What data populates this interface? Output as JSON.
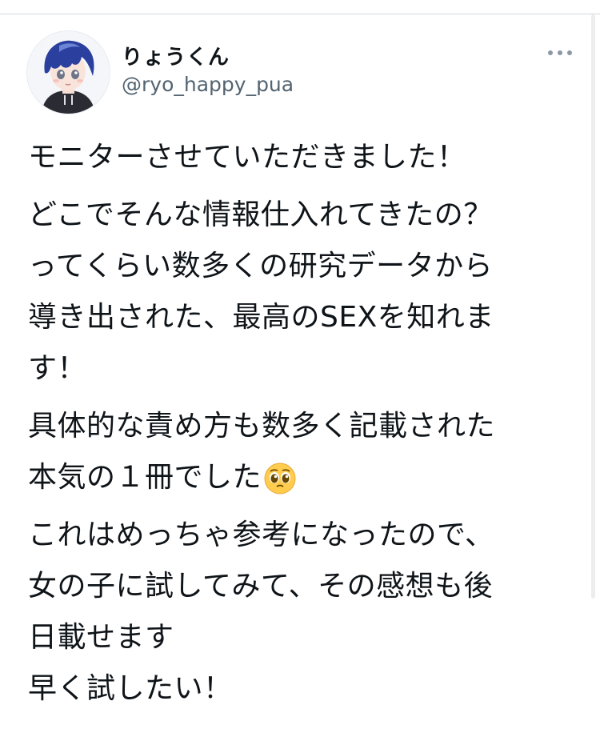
{
  "tweet": {
    "author": {
      "display_name": "りょうくん",
      "handle": "@ryo_happy_pua",
      "avatar_icon": "anime-boy-avatar"
    },
    "more_icon": "more-horizontal-icon",
    "paragraphs": [
      {
        "lines": [
          "モニターさせていただきました！"
        ]
      },
      {
        "lines": [
          "どこでそんな情報仕入れてきたの？",
          "ってくらい数多くの研究データから",
          "導き出された、最高のSEXを知れま",
          "す！"
        ]
      },
      {
        "lines": [
          "具体的な責め方も数多く記載された",
          "本気の１冊でした"
        ],
        "emoji": "pleading-face-emoji"
      },
      {
        "lines": [
          "これはめっちゃ参考になったので、",
          "女の子に試してみて、その感想も後",
          "日載せます",
          "早く試したい！"
        ]
      }
    ]
  },
  "colors": {
    "text": "#0f1419",
    "secondary_text": "#536471",
    "divider": "#cfd9de",
    "avatar_hair": "#2a3f9e"
  }
}
